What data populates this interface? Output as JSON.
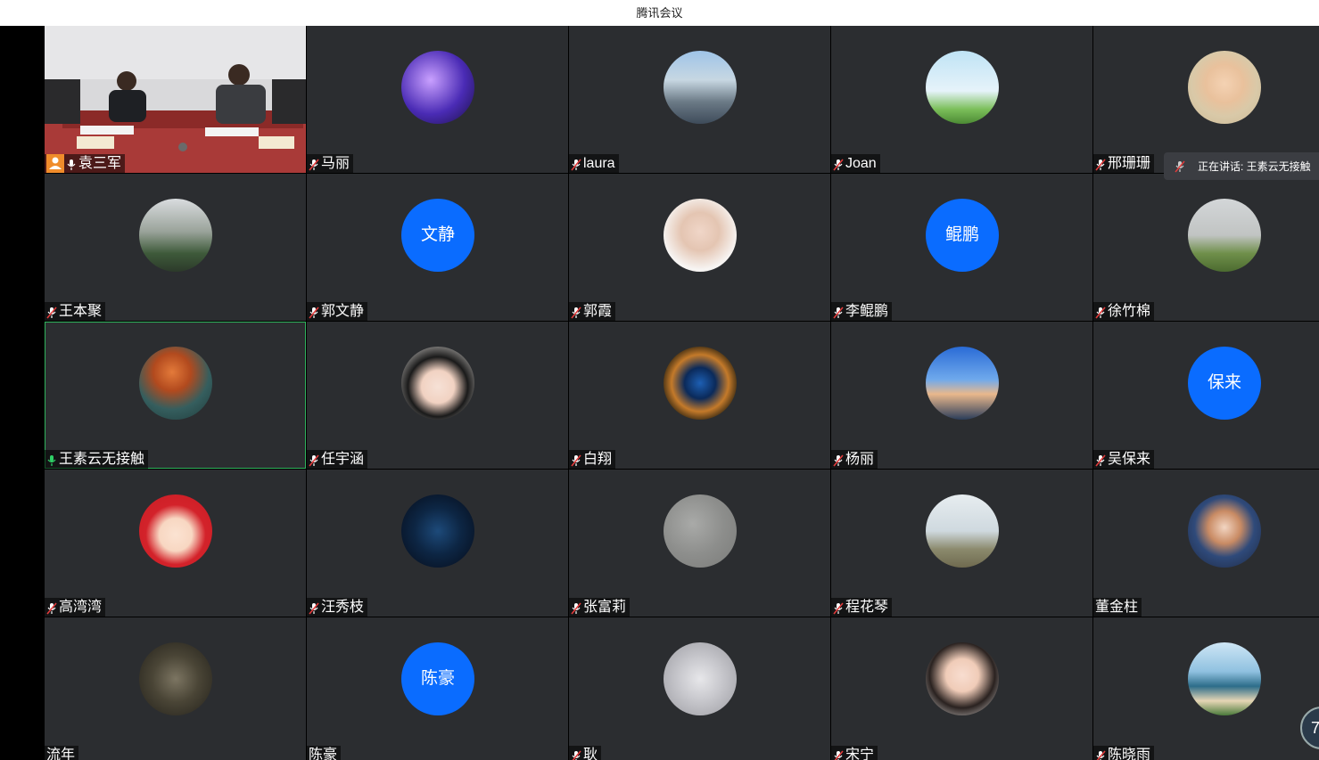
{
  "window": {
    "title": "腾讯会议"
  },
  "speaking_indicator": {
    "label": "正在讲话: 王素云无接触"
  },
  "corner_badge": {
    "text": "7"
  },
  "participants": [
    {
      "name": "袁三军",
      "mic": "on",
      "host": true,
      "video": true
    },
    {
      "name": "马丽",
      "mic": "muted",
      "avatar": "purple-sky"
    },
    {
      "name": "laura",
      "mic": "muted",
      "avatar": "photo-person-outdoor"
    },
    {
      "name": "Joan",
      "mic": "muted",
      "avatar": "sky-grass"
    },
    {
      "name": "邢珊珊",
      "mic": "muted",
      "avatar": "illustrated-woman"
    },
    {
      "name": "王本聚",
      "mic": "muted",
      "avatar": "photo-trees"
    },
    {
      "name": "郭文静",
      "mic": "muted",
      "initials": "文静"
    },
    {
      "name": "郭霞",
      "mic": "muted",
      "avatar": "photo-child"
    },
    {
      "name": "李鲲鹏",
      "mic": "muted",
      "initials": "鲲鹏"
    },
    {
      "name": "徐竹棉",
      "mic": "muted",
      "avatar": "photo-field"
    },
    {
      "name": "王素云无接触",
      "mic": "speaking",
      "avatar": "autumn-tree",
      "speaking": true
    },
    {
      "name": "任宇涵",
      "mic": "muted",
      "avatar": "illustrated-girl"
    },
    {
      "name": "白翔",
      "mic": "muted",
      "avatar": "spiral-stair"
    },
    {
      "name": "杨丽",
      "mic": "muted",
      "avatar": "blue-sky-sea"
    },
    {
      "name": "吴保来",
      "mic": "muted",
      "initials": "保来"
    },
    {
      "name": "高湾湾",
      "mic": "muted",
      "avatar": "cartoon-girl"
    },
    {
      "name": "汪秀枝",
      "mic": "muted",
      "avatar": "night-stars"
    },
    {
      "name": "张富莉",
      "mic": "muted",
      "avatar": "gray-texture"
    },
    {
      "name": "程花琴",
      "mic": "muted",
      "avatar": "photo-person-field"
    },
    {
      "name": "董金柱",
      "mic": "none",
      "avatar": "photo-child-cap"
    },
    {
      "name": "流年",
      "mic": "none",
      "avatar": "photo-couple"
    },
    {
      "name": "陈豪",
      "mic": "none",
      "initials": "陈豪"
    },
    {
      "name": "耿",
      "mic": "muted",
      "avatar": "photo-cat"
    },
    {
      "name": "宋宁",
      "mic": "muted",
      "avatar": "illustrated-woman-2"
    },
    {
      "name": "陈晓雨",
      "mic": "muted",
      "avatar": "photo-beach"
    }
  ],
  "colors": {
    "tile_bg": "#2b2d30",
    "initials_bg": "#0a6cff",
    "speaking_border": "#2fb35c",
    "host_badge": "#f08c2b"
  }
}
